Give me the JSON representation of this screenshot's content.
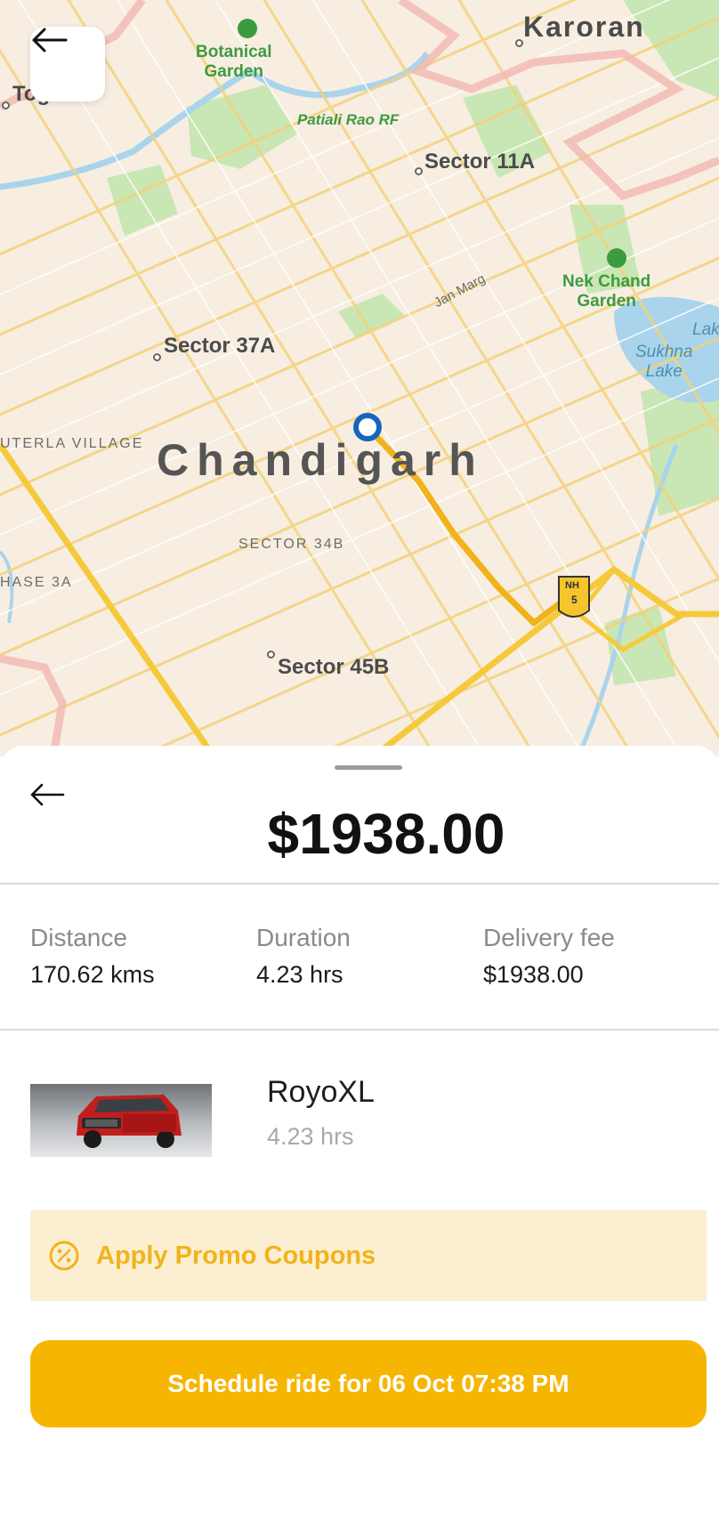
{
  "map": {
    "labels": {
      "city": "Chandigarh",
      "karoran": "Karoran",
      "toga": "Toga",
      "botanical_garden": "Botanical\nGarden",
      "patiali_rao": "Patiali Rao RF",
      "sector_11a": "Sector 11A",
      "jan_marg": "Jan Marg",
      "nek_chand": "Nek Chand\nGarden",
      "sukhna_lake": "Sukhna\nLake",
      "lake_edge": "Lak",
      "sector_37a": "Sector 37A",
      "buterla": "UTERLA VILLAGE",
      "sector_34b": "SECTOR 34B",
      "phase_3a": "HASE 3A",
      "sector_45b": "Sector 45B",
      "nh_badge_top": "NH",
      "nh_badge_num": "5"
    },
    "colors": {
      "land": "#f7eee1",
      "park": "#c9e6b5",
      "water": "#a9d4ec",
      "route": "#f2b21a",
      "border": "#f1b7b0",
      "pin": "#1565c0"
    }
  },
  "sheet": {
    "price": "$1938.00",
    "stats": [
      {
        "label": "Distance",
        "value": "170.62 kms"
      },
      {
        "label": "Duration",
        "value": "4.23 hrs"
      },
      {
        "label": "Delivery fee",
        "value": "$1938.00"
      }
    ],
    "vehicle": {
      "name": "RoyoXL",
      "duration": "4.23 hrs"
    },
    "promo_label": "Apply Promo Coupons",
    "cta_label": "Schedule ride for 06 Oct 07:38 PM"
  },
  "icons": {
    "map_back": "arrow-left-icon",
    "sheet_back": "arrow-left-icon",
    "promo": "percent-badge-icon",
    "park": "tree-icon"
  }
}
